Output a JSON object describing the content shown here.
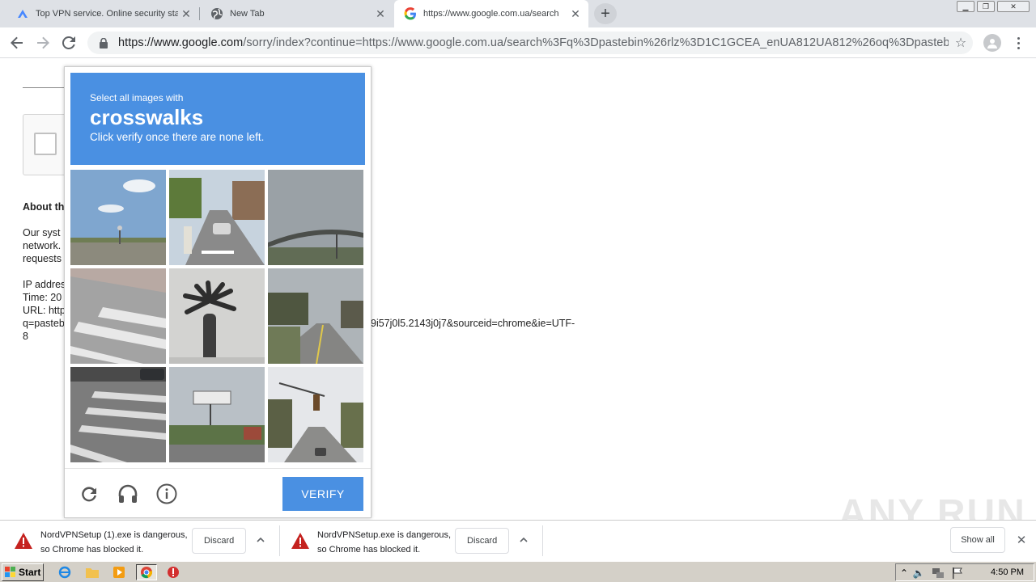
{
  "browser": {
    "tabs": [
      {
        "title": "Top VPN service. Online security sta",
        "icon": "nordvpn-icon",
        "active": false
      },
      {
        "title": "New Tab",
        "icon": "globe-icon",
        "active": false
      },
      {
        "title": "https://www.google.com.ua/search",
        "icon": "google-g-icon",
        "active": true
      }
    ],
    "new_tab_label": "+",
    "tab_close_glyph": "✕",
    "url_host": "https://www.google.com",
    "url_rest": "/sorry/index?continue=https://www.google.com.ua/search%3Fq%3Dpastebin%26rlz%3D1C1GCEA_enUA812UA812%26oq%3Dpastebin..."
  },
  "page": {
    "about_heading": "About th",
    "para_lines": [
      "Our syst",
      "network.",
      "requests"
    ],
    "ip_line": "IP addres",
    "time_line": "Time: 20",
    "url_line": "URL: http",
    "q_line": "q=pasteb",
    "q_tail": "9i57j0l5.2143j0j7&sourceid=chrome&ie=UTF-",
    "eight": "8"
  },
  "captcha": {
    "prompt_small": "Select all images with",
    "prompt_big": "crosswalks",
    "prompt_hint": "Click verify once there are none left.",
    "verify_label": "VERIFY",
    "tiles": [
      "sky-streetlight",
      "road-cars",
      "overpass",
      "crosswalk-stripes",
      "palm-tree",
      "road-trees",
      "crosswalk-intersection",
      "traffic-sign",
      "traffic-light-road"
    ]
  },
  "downloads": {
    "items": [
      {
        "line1": "NordVPNSetup (1).exe is dangerous,",
        "line2": "so Chrome has blocked it.",
        "discard": "Discard"
      },
      {
        "line1": "NordVPNSetup.exe is dangerous,",
        "line2": "so Chrome has blocked it.",
        "discard": "Discard"
      }
    ],
    "show_all": "Show all"
  },
  "watermark": "ANY RUN",
  "taskbar": {
    "start_label": "Start",
    "clock": "4:50 PM"
  }
}
